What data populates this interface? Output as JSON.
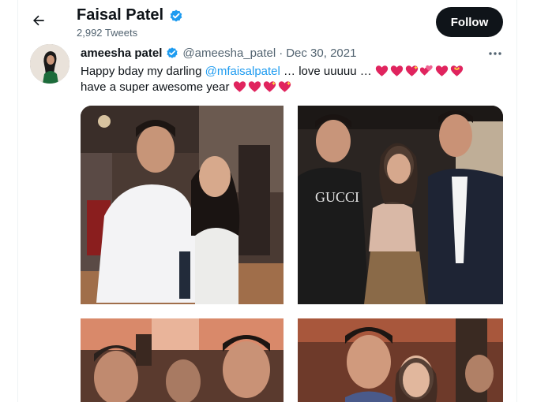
{
  "header": {
    "title": "Faisal Patel",
    "tweets_count": "2,992 Tweets",
    "follow_label": "Follow"
  },
  "tweet": {
    "author_name": "ameesha patel",
    "author_handle": "@ameesha_patel",
    "separator": "·",
    "date": "Dec 30, 2021",
    "text_part1": "Happy bday my darling ",
    "mention": "@mfaisalpatel",
    "text_part2": " … love uuuuu … ",
    "text_line2": "have a super awesome year ",
    "emoji_line1": [
      "red-heart",
      "red-heart",
      "sparkling-heart",
      "two-hearts",
      "red-heart",
      "heart-with-ribbon"
    ],
    "emoji_line2": [
      "red-heart",
      "red-heart",
      "sparkling-heart",
      "sparkling-heart"
    ]
  },
  "media": {
    "photo_count": 4
  },
  "colors": {
    "accent": "#1d9bf0",
    "verified": "#1d9bf0",
    "follow_bg": "#0f1419",
    "secondary_text": "#536471",
    "heart": "#e0245e"
  }
}
